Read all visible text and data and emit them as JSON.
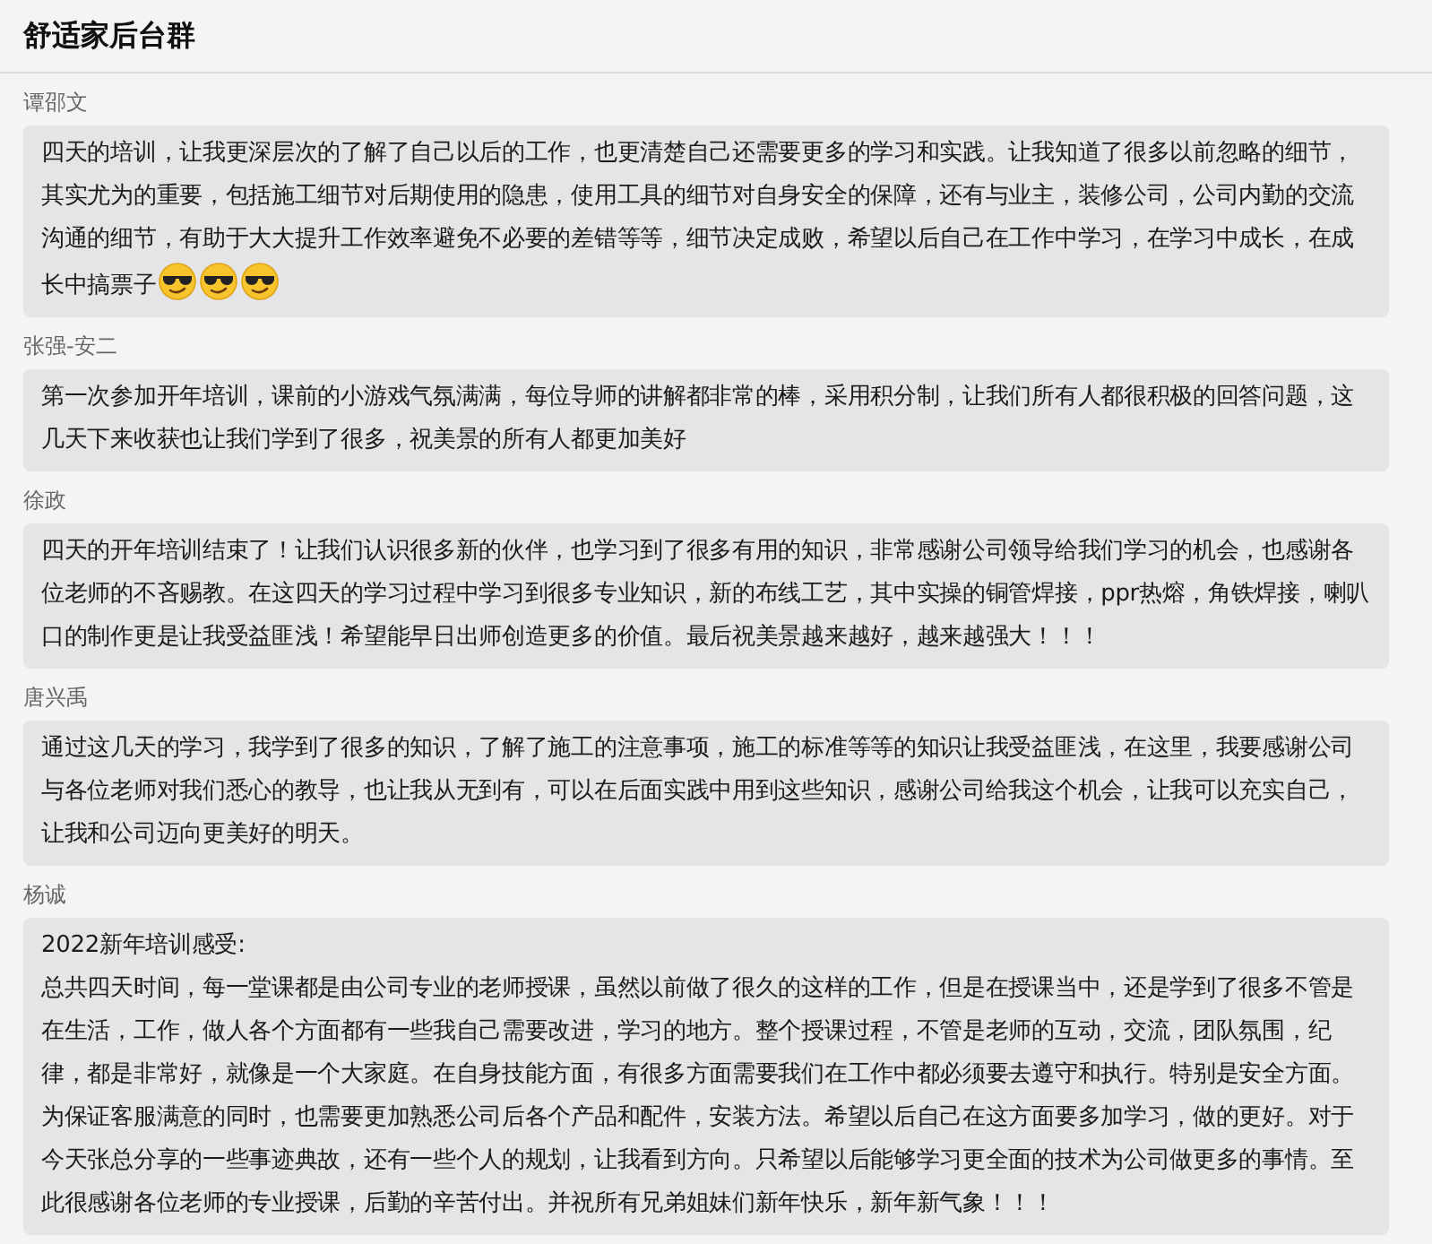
{
  "header": {
    "title": "舒适家后台群"
  },
  "messages": [
    {
      "sender": "谭邵文",
      "paragraphs": [
        "四天的培训，让我更深层次的了解了自己以后的工作，也更清楚自己还需要更多的学习和实践。让我知道了很多以前忽略的细节，其实尤为的重要，包括施工细节对后期使用的隐患，使用工具的细节对自身安全的保障，还有与业主，装修公司，公司内勤的交流沟通的细节，有助于大大提升工作效率避免不必要的差错等等，细节决定成败，希望以后自己在工作中学习，在学习中成长，在成长中搞票子"
      ],
      "emojis": [
        {
          "kind": "sunglasses"
        },
        {
          "kind": "sunglasses"
        },
        {
          "kind": "sunglasses"
        }
      ]
    },
    {
      "sender": "张强-安二",
      "paragraphs": [
        "第一次参加开年培训，课前的小游戏气氛满满，每位导师的讲解都非常的棒，采用积分制，让我们所有人都很积极的回答问题，这几天下来收获也让我们学到了很多，祝美景的所有人都更加美好"
      ]
    },
    {
      "sender": "徐政",
      "paragraphs": [
        "四天的开年培训结束了！让我们认识很多新的伙伴，也学习到了很多有用的知识，非常感谢公司领导给我们学习的机会，也感谢各位老师的不吝赐教。在这四天的学习过程中学习到很多专业知识，新的布线工艺，其中实操的铜管焊接，ppr热熔，角铁焊接，喇叭口的制作更是让我受益匪浅！希望能早日出师创造更多的价值。最后祝美景越来越好，越来越强大！！！"
      ]
    },
    {
      "sender": "唐兴禹",
      "paragraphs": [
        "通过这几天的学习，我学到了很多的知识，了解了施工的注意事项，施工的标准等等的知识让我受益匪浅，在这里，我要感谢公司与各位老师对我们悉心的教导，也让我从无到有，可以在后面实践中用到这些知识，感谢公司给我这个机会，让我可以充实自己，让我和公司迈向更美好的明天。"
      ]
    },
    {
      "sender": "杨诚",
      "paragraphs": [
        "2022新年培训感受:",
        "总共四天时间，每一堂课都是由公司专业的老师授课，虽然以前做了很久的这样的工作，但是在授课当中，还是学到了很多不管是在生活，工作，做人各个方面都有一些我自己需要改进，学习的地方。整个授课过程，不管是老师的互动，交流，团队氛围，纪律，都是非常好，就像是一个大家庭。在自身技能方面，有很多方面需要我们在工作中都必须要去遵守和执行。特别是安全方面。为保证客服满意的同时，也需要更加熟悉公司后各个产品和配件，安装方法。希望以后自己在这方面要多加学习，做的更好。对于今天张总分享的一些事迹典故，还有一些个人的规划，让我看到方向。只希望以后能够学习更全面的技术为公司做更多的事情。至此很感谢各位老师的专业授课，后勤的辛苦付出。并祝所有兄弟姐妹们新年快乐，新年新气象！！！"
      ]
    }
  ]
}
